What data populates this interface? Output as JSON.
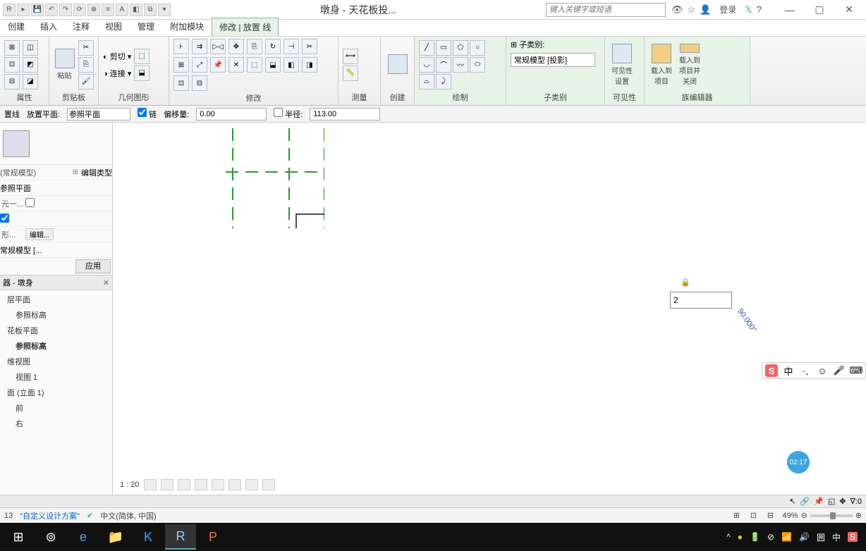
{
  "title": "墩身 - 天花板投...",
  "search_placeholder": "键入关键字或短语",
  "login_label": "登录",
  "menu_tabs": [
    "创建",
    "插入",
    "注释",
    "视图",
    "管理",
    "附加模块",
    "修改 | 放置 线"
  ],
  "menu_active_index": 6,
  "ribbon_groups": {
    "properties": "属性",
    "clipboard": "剪贴板",
    "clipboard_paste": "粘贴",
    "geometry": "几何图形",
    "geometry_cut": "剪切",
    "geometry_join": "连接",
    "modify": "修改",
    "measure": "测量",
    "create": "创建",
    "draw": "绘制",
    "subcategory": "子类别",
    "subcategory_label": "子类别:",
    "subcategory_value": "常规模型 [投影]",
    "visibility": "可见性",
    "visibility_btn": "可见性\n设置",
    "family_editor": "族编辑器",
    "load_project": "载入到\n项目",
    "load_close": "载入到\n项目并关闭"
  },
  "options": {
    "line_label": "置线",
    "plane_label": "放置平面:",
    "plane_value": "参照平面",
    "chain_label": "链",
    "offset_label": "偏移量:",
    "offset_value": "0.00",
    "radius_label": "半径:",
    "radius_value": "113.00"
  },
  "properties_panel": {
    "type_name": "(常规模型)",
    "edit_type": "编辑类型",
    "row_ref": "参照平面",
    "row_unit": "元一...",
    "row_shape": "形...",
    "row_edit_btn": "编辑...",
    "row_model": "常规模型 [...",
    "apply": "应用"
  },
  "browser": {
    "title": "器 - 墩身",
    "items": [
      "层平面",
      "参照标高",
      "花板平面",
      "参照标高",
      "维视图",
      "视图 1",
      "面 (立面 1)",
      "前",
      "右"
    ]
  },
  "canvas": {
    "input_value": "2",
    "angle_text": "90.000°",
    "dim_symbol": "🔒"
  },
  "viewbar": {
    "scale": "1 : 20"
  },
  "ime_bar": {
    "s_label": "S",
    "lang": "中"
  },
  "status": {
    "item1": "13",
    "item2": "\"自定义设计方案\"",
    "lang": "中文(简体, 中国)",
    "zoom": "49%",
    "filter": "∇:0"
  },
  "badge_time": "02:17",
  "taskbar": {
    "items": [
      "⊞",
      "⊚",
      "e",
      "📁",
      "K",
      "R",
      "P"
    ]
  },
  "win_controls": {
    "min": "—",
    "max": "▢",
    "close": "✕"
  }
}
